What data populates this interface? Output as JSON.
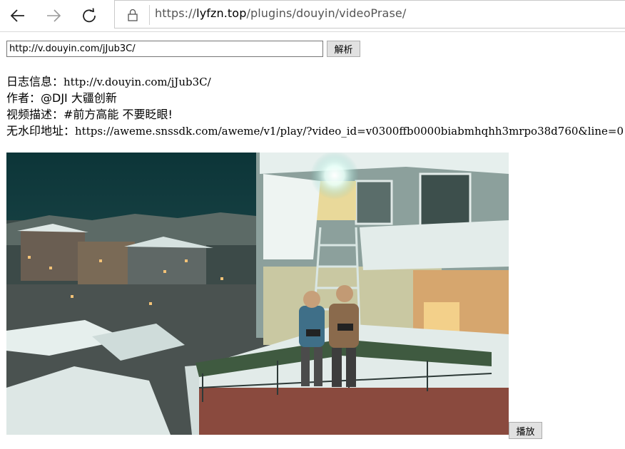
{
  "browser": {
    "url_prefix": "https://",
    "url_host": "lyfzn.top",
    "url_path": "/plugins/douyin/videoPrase/",
    "icons": [
      "back-arrow-icon",
      "forward-arrow-icon",
      "refresh-icon",
      "lock-icon"
    ]
  },
  "form": {
    "input_value": "http://v.douyin.com/jJub3C/",
    "parse_label": "解析"
  },
  "info": {
    "log_label": "日志信息：",
    "log_value": "http://v.douyin.com/jJub3C/",
    "author_label": "作者：",
    "author_value": "@DJI 大疆创新",
    "desc_label": "视频描述：",
    "desc_value": "#前方高能 不要眨眼!",
    "nowm_label": "无水印地址：",
    "nowm_value": "https://aweme.snssdk.com/aweme/v1/play/?video_id=v0300ffb0000biabmhqhh3mrpo38d760&line=0"
  },
  "video": {
    "play_label": "播放"
  },
  "colors": {
    "sky": "#0f3a40",
    "window_glow": "#f4e7b0",
    "snow": "#dfe8e6"
  }
}
